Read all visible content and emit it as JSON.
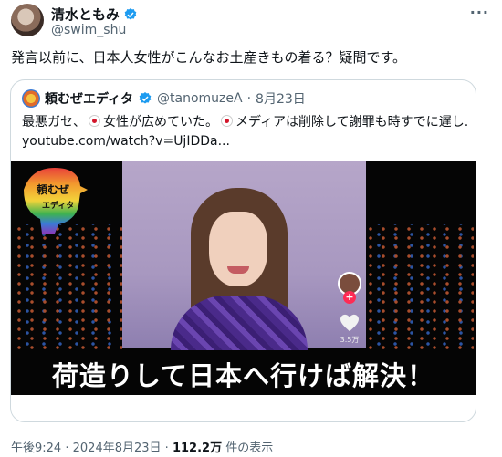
{
  "author": {
    "display_name": "清水ともみ",
    "handle": "@swim_shu",
    "avatar_icon": "profile-avatar",
    "verified_icon": "verified-badge-icon",
    "verified_color": "#1d9bf0"
  },
  "more_icon": "more-options-icon",
  "tweet": {
    "text": "発言以前に、日本人女性がこんなお土産きもの着る？疑問です。"
  },
  "quote": {
    "display_name": "頼むぜエディタ",
    "handle": "@tanomuzeA",
    "separator": "·",
    "date": "8月23日",
    "line1_a": "最悪ガセ、",
    "line1_b": "女性が広めていた。",
    "line1_c": "メディアは削除して謝罪も時すでに遅し...",
    "link": "youtube.com/watch?v=UjIDDa...",
    "flag_icon": "japan-flag-icon",
    "video": {
      "logo_text_1": "頼むぜ",
      "logo_text_2": "エディタ",
      "like_count": "3.5万",
      "caption": "荷造りして日本へ行けば解決！"
    }
  },
  "footer": {
    "time": "午後9:24",
    "separator": "·",
    "date": "2024年8月23日",
    "separator2": "·",
    "views": "112.2万",
    "views_label": "件の表示"
  }
}
